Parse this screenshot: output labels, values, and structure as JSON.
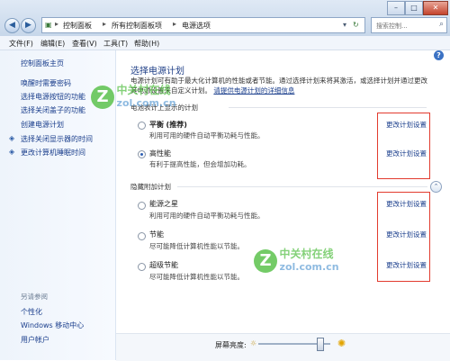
{
  "window": {
    "controls": {
      "minimize": "–",
      "maximize": "□",
      "close": "✕"
    }
  },
  "address": {
    "crumbs": [
      "控制面板",
      "所有控制面板项",
      "电源选项"
    ],
    "separator": "▸"
  },
  "search": {
    "placeholder": "搜索控制..."
  },
  "menu": {
    "file": "文件(F)",
    "edit": "编辑(E)",
    "view": "查看(V)",
    "tools": "工具(T)",
    "help": "帮助(H)"
  },
  "sidebar": {
    "home": "控制面板主页",
    "items": [
      "唤醒时需要密码",
      "选择电源按钮的功能",
      "选择关闭盖子的功能",
      "创建电源计划",
      "选择关闭显示器的时间",
      "更改计算机睡眠时间"
    ],
    "see_also_title": "另请参阅",
    "see_also": [
      "个性化",
      "Windows 移动中心",
      "用户帐户"
    ]
  },
  "main": {
    "heading": "选择电源计划",
    "description": "电源计划可有助于最大化计算机的性能或者节能。通过选择计划来将其激活，或选择计划并通过更改其电源设置来自定义计划。",
    "description_link": "请提供电源计划的详细信息",
    "battery_group": "电池表计上显示的计划",
    "plans": [
      {
        "name": "平衡",
        "tag": "(推荐)",
        "desc": "利用可用的硬件自动平衡功耗与性能。",
        "selected": false
      },
      {
        "name": "高性能",
        "tag": "",
        "desc": "有利于提高性能，但会增加功耗。",
        "selected": true
      }
    ],
    "hidden_group": "隐藏附加计划",
    "hidden_plans": [
      {
        "name": "能源之星",
        "desc": "利用可用的硬件自动平衡功耗与性能。",
        "selected": false
      },
      {
        "name": "节能",
        "desc": "尽可能降低计算机性能以节能。",
        "selected": false
      },
      {
        "name": "超级节能",
        "desc": "尽可能降低计算机性能以节能。",
        "selected": false
      }
    ],
    "change_link": "更改计划设置"
  },
  "bottom": {
    "brightness_label": "屏幕亮度:",
    "brightness_level": 0.85
  },
  "watermark": {
    "line1": "中关村在线",
    "line2": "zol.com.cn"
  },
  "colors": {
    "link": "#1a3e8c",
    "heading": "#1f3f87",
    "highlight_box": "#e23b2e",
    "watermark_green": "#5cc24d"
  }
}
